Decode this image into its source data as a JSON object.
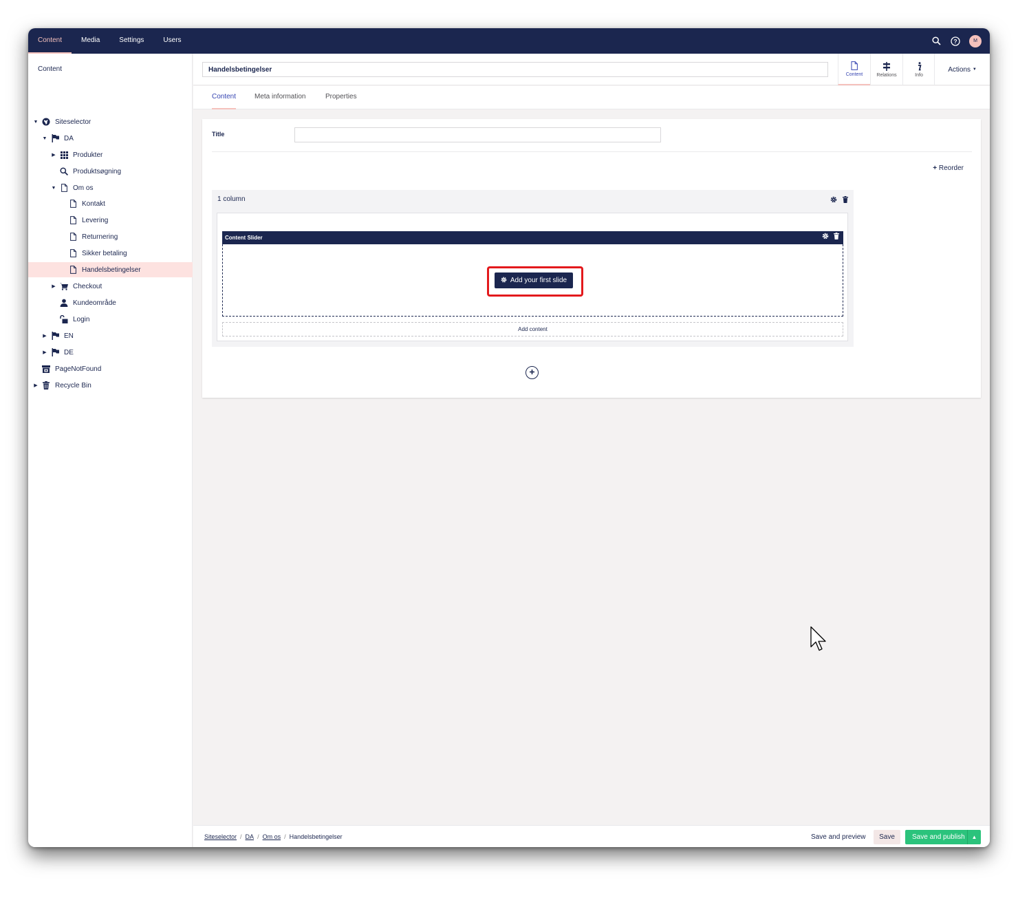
{
  "topnav": {
    "items": [
      "Content",
      "Media",
      "Settings",
      "Users"
    ],
    "avatar_initial": "M"
  },
  "sidebar": {
    "title": "Content",
    "tree": [
      {
        "label": "Siteselector",
        "icon": "globe-icon"
      },
      {
        "label": "DA",
        "icon": "flag-icon"
      },
      {
        "label": "Produkter",
        "icon": "grid-icon"
      },
      {
        "label": "Produktsøgning",
        "icon": "search-icon"
      },
      {
        "label": "Om os",
        "icon": "page-icon"
      },
      {
        "label": "Kontakt",
        "icon": "page-icon"
      },
      {
        "label": "Levering",
        "icon": "page-icon"
      },
      {
        "label": "Returnering",
        "icon": "page-icon"
      },
      {
        "label": "Sikker betaling",
        "icon": "page-icon"
      },
      {
        "label": "Handelsbetingelser",
        "icon": "page-icon"
      },
      {
        "label": "Checkout",
        "icon": "cart-icon"
      },
      {
        "label": "Kundeområde",
        "icon": "user-icon"
      },
      {
        "label": "Login",
        "icon": "unlock-icon"
      },
      {
        "label": "EN",
        "icon": "flag-icon"
      },
      {
        "label": "DE",
        "icon": "flag-icon"
      },
      {
        "label": "PageNotFound",
        "icon": "box-icon"
      },
      {
        "label": "Recycle Bin",
        "icon": "trash-icon"
      }
    ]
  },
  "editor": {
    "name_value": "Handelsbetingelser",
    "apps": [
      {
        "label": "Content",
        "icon": "page-icon"
      },
      {
        "label": "Relations",
        "icon": "relations-icon"
      },
      {
        "label": "Info",
        "icon": "info-icon"
      }
    ],
    "actions_label": "Actions",
    "tabs": [
      "Content",
      "Meta information",
      "Properties"
    ]
  },
  "form": {
    "title_label": "Title",
    "title_value": "",
    "reorder_label": "Reorder",
    "row_label": "1 column",
    "control_title": "Content Slider",
    "add_slide_label": "Add your first slide",
    "add_content_label": "Add content"
  },
  "footer": {
    "breadcrumbs": [
      "Siteselector",
      "DA",
      "Om os",
      "Handelsbetingelser"
    ],
    "save_preview_label": "Save and preview",
    "save_label": "Save",
    "publish_label": "Save and publish"
  },
  "colors": {
    "navy": "#1b264f",
    "accent_pink": "#f5c1bc",
    "publish_green": "#2bc37c",
    "highlight_red": "#e3191c"
  }
}
